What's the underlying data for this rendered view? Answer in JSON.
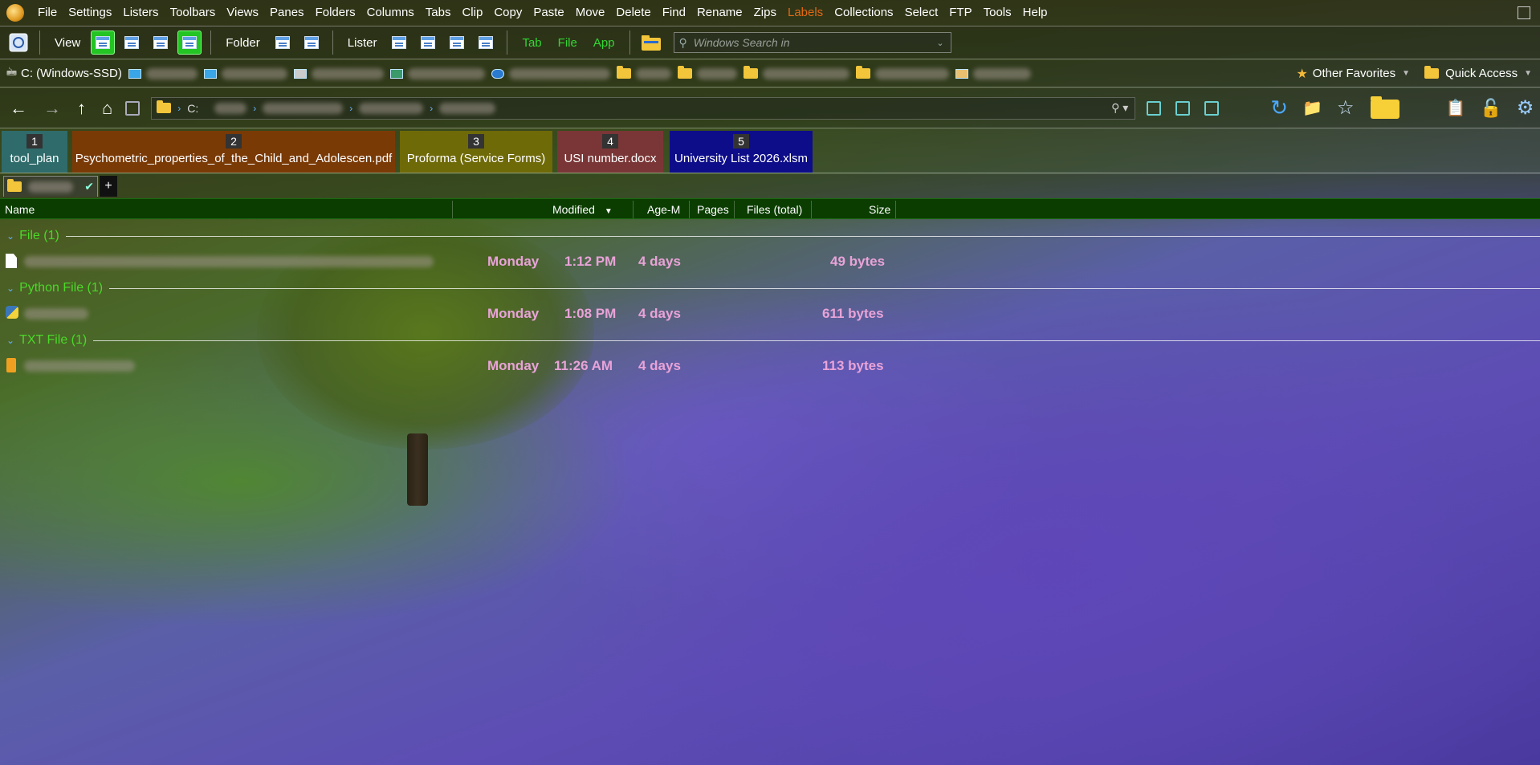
{
  "menu": [
    "File",
    "Settings",
    "Listers",
    "Toolbars",
    "Views",
    "Panes",
    "Folders",
    "Columns",
    "Tabs",
    "Clip",
    "Copy",
    "Paste",
    "Move",
    "Delete",
    "Find",
    "Rename",
    "Zips",
    "Labels",
    "Collections",
    "Select",
    "FTP",
    "Tools",
    "Help"
  ],
  "toolbar": {
    "view_label": "View",
    "folder_label": "Folder",
    "lister_label": "Lister",
    "tab_label": "Tab",
    "file_label": "File",
    "app_label": "App",
    "search_placeholder": "Windows Search in"
  },
  "favorites": {
    "drive_label": "C: (Windows-SSD)",
    "other_favorites": "Other Favorites",
    "quick_access": "Quick Access"
  },
  "location": {
    "drive": "C:"
  },
  "folder_tabs": [
    {
      "num": "1",
      "name": "tool_plan",
      "color": "#2f6b6b"
    },
    {
      "num": "2",
      "name": "Psychometric_properties_of_the_Child_and_Adolescen.pdf",
      "color": "#7a3a06"
    },
    {
      "num": "3",
      "name": "Proforma (Service Forms)",
      "color": "#6f6a08"
    },
    {
      "num": "4",
      "name": "USI number.docx",
      "color": "#7a3636"
    },
    {
      "num": "5",
      "name": "University List 2026.xlsm",
      "color": "#0d0d8a"
    }
  ],
  "columns": {
    "name": "Name",
    "modified": "Modified",
    "age": "Age-M",
    "pages": "Pages",
    "files_total": "Files (total)",
    "size": "Size"
  },
  "groups": [
    {
      "label": "File (1)",
      "file": {
        "day": "Monday",
        "time": "1:12 PM",
        "age": "4 days",
        "size": "49 bytes",
        "icon": "file-icon"
      }
    },
    {
      "label": "Python File (1)",
      "file": {
        "day": "Monday",
        "time": "1:08 PM",
        "age": "4 days",
        "size": "611 bytes",
        "icon": "python-file-icon"
      }
    },
    {
      "label": "TXT File (1)",
      "file": {
        "day": "Monday",
        "time": "11:26 AM",
        "age": "4 days",
        "size": "113 bytes",
        "icon": "text-file-icon"
      }
    }
  ],
  "colors": {
    "accent_green": "#4bd82a",
    "row_text": "#e9a3d8",
    "header_bg": "#0b3d00",
    "labels_menu": "#e06a14"
  }
}
